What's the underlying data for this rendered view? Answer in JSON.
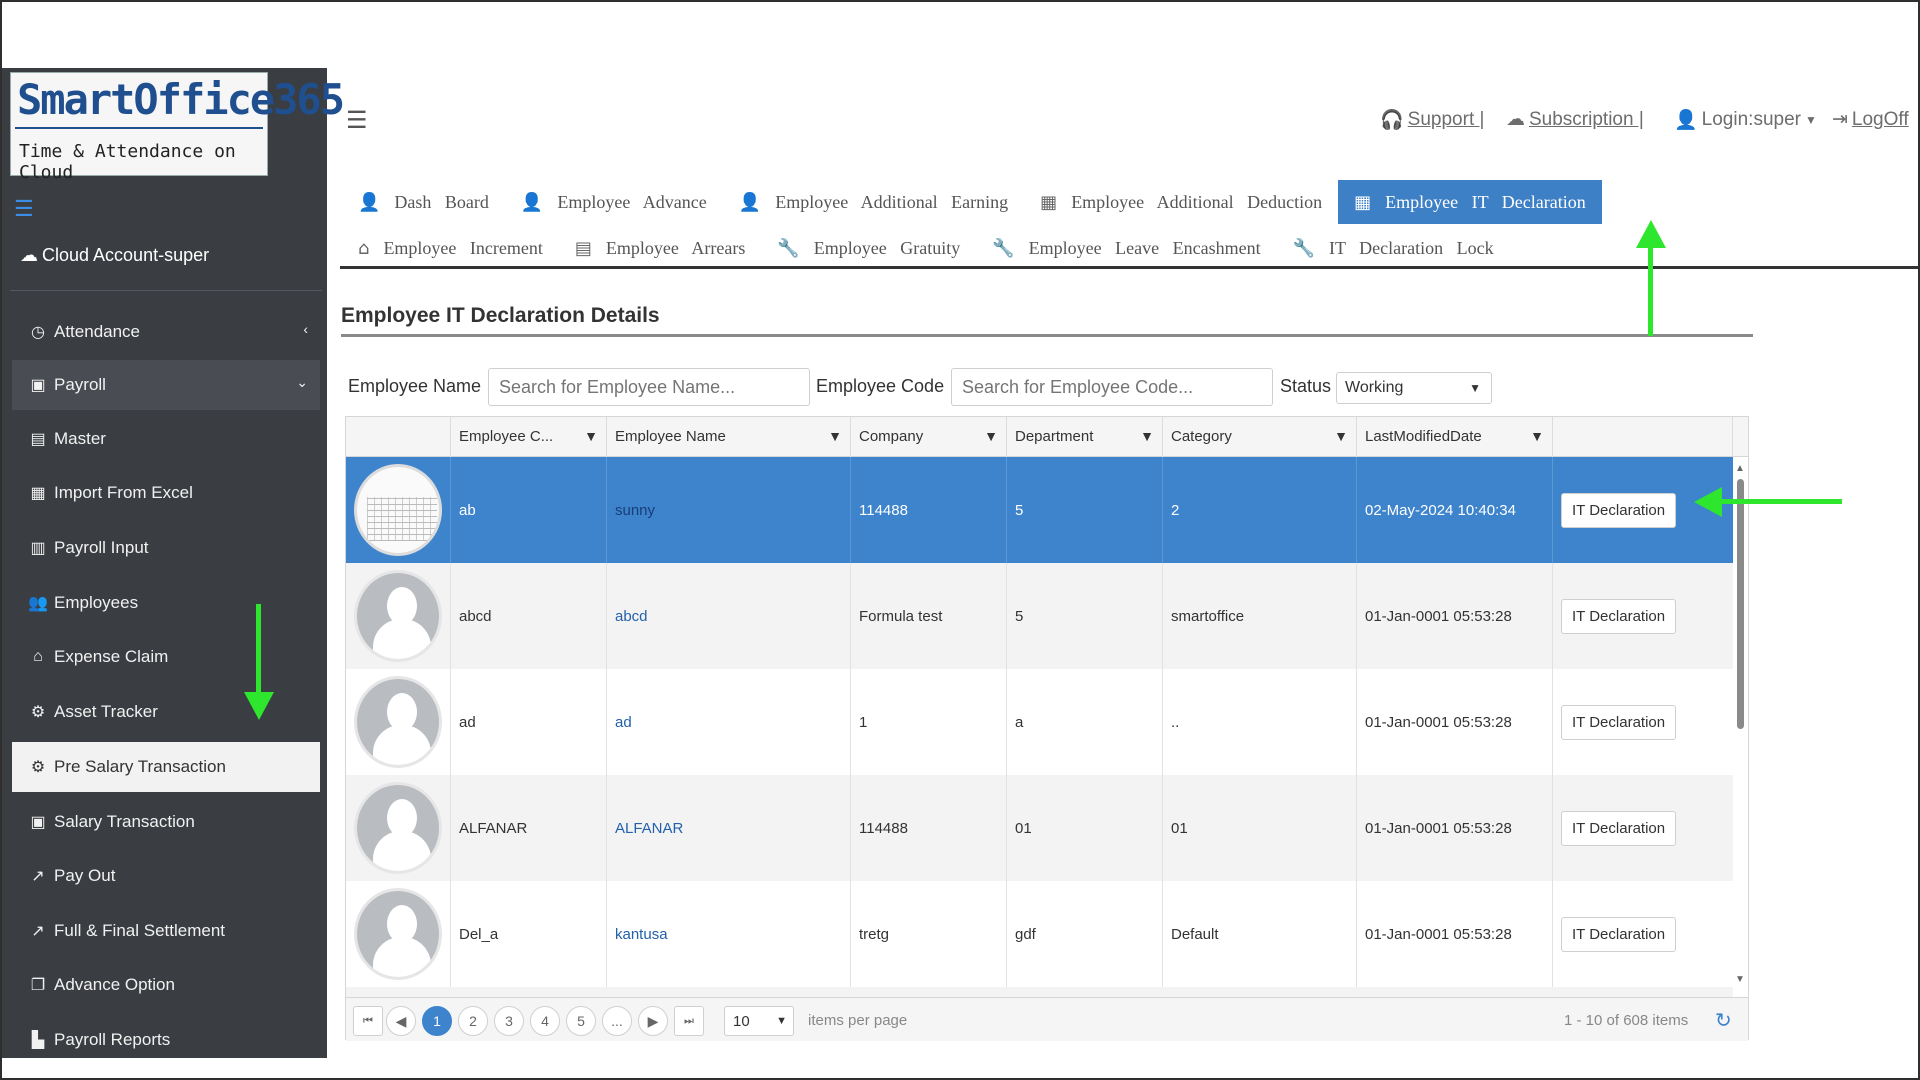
{
  "app": {
    "logo_title": "SmartOffice365",
    "logo_subtitle": "Time & Attendance on Cloud"
  },
  "sidebar": {
    "account": "Cloud Account-super",
    "items": [
      {
        "label": "Attendance",
        "icon": "clock-icon"
      },
      {
        "label": "Payroll",
        "icon": "money-icon"
      },
      {
        "label": "Master",
        "icon": "master-icon"
      },
      {
        "label": "Import From Excel",
        "icon": "excel-icon"
      },
      {
        "label": "Payroll Input",
        "icon": "input-icon"
      },
      {
        "label": "Employees",
        "icon": "users-icon"
      },
      {
        "label": "Expense Claim",
        "icon": "bank-icon"
      },
      {
        "label": "Asset Tracker",
        "icon": "assets-icon"
      },
      {
        "label": "Pre Salary Transaction",
        "icon": "gear-icon"
      },
      {
        "label": "Salary Transaction",
        "icon": "money-icon"
      },
      {
        "label": "Pay Out",
        "icon": "share-icon"
      },
      {
        "label": "Full & Final Settlement",
        "icon": "share-icon"
      },
      {
        "label": "Advance Option",
        "icon": "copy-icon"
      },
      {
        "label": "Payroll Reports",
        "icon": "chart-icon"
      }
    ]
  },
  "topbar": {
    "support": "Support |",
    "subscription": "Subscription |",
    "login": "Login:super",
    "logoff": "LogOff"
  },
  "tabs": {
    "row1": [
      {
        "label": "Dash   Board",
        "icon": "user-icon"
      },
      {
        "label": "Employee   Advance",
        "icon": "user-icon"
      },
      {
        "label": "Employee   Additional   Earning",
        "icon": "user-icon"
      },
      {
        "label": "Employee   Additional   Deduction",
        "icon": "grid-icon"
      },
      {
        "label": "Employee   IT   Declaration",
        "icon": "grid-icon"
      }
    ],
    "row2": [
      {
        "label": "Employee   Increment",
        "icon": "home-icon"
      },
      {
        "label": "Employee   Arrears",
        "icon": "list-icon"
      },
      {
        "label": "Employee   Gratuity",
        "icon": "wrench-icon"
      },
      {
        "label": "Employee   Leave   Encashment",
        "icon": "wrench-icon"
      },
      {
        "label": "IT   Declaration   Lock",
        "icon": "wrench-icon"
      }
    ]
  },
  "page": {
    "title": "Employee IT Declaration Details"
  },
  "filters": {
    "name_label": "Employee Name",
    "name_placeholder": "Search for Employee Name...",
    "code_label": "Employee Code",
    "code_placeholder": "Search for Employee Code...",
    "status_label": "Status",
    "status_value": "Working"
  },
  "grid": {
    "columns": [
      "Employee C...",
      "Employee Name",
      "Company",
      "Department",
      "Category",
      "LastModifiedDate"
    ],
    "action_label": "IT Declaration",
    "rows": [
      {
        "code": "ab",
        "name": "sunny",
        "company": "114488",
        "department": "5",
        "category": "2",
        "modified": "02-May-2024 10:40:34"
      },
      {
        "code": "abcd",
        "name": "abcd",
        "company": "Formula test",
        "department": "5",
        "category": "smartoffice",
        "modified": "01-Jan-0001 05:53:28"
      },
      {
        "code": "ad",
        "name": "ad",
        "company": "1",
        "department": "a",
        "category": "..",
        "modified": "01-Jan-0001 05:53:28"
      },
      {
        "code": "ALFANAR",
        "name": "ALFANAR",
        "company": "114488",
        "department": "01",
        "category": "01",
        "modified": "01-Jan-0001 05:53:28"
      },
      {
        "code": "Del_a",
        "name": "kantusa",
        "company": "tretg",
        "department": "gdf",
        "category": "Default",
        "modified": "01-Jan-0001 05:53:28"
      }
    ]
  },
  "pager": {
    "pages": [
      "1",
      "2",
      "3",
      "4",
      "5",
      "..."
    ],
    "page_size": "10",
    "items_per_page": "items per page",
    "summary": "1 - 10 of 608 items"
  },
  "colors": {
    "accent": "#3d84cc",
    "sidebar": "#3a3d42",
    "annotation": "#2ee62e"
  }
}
